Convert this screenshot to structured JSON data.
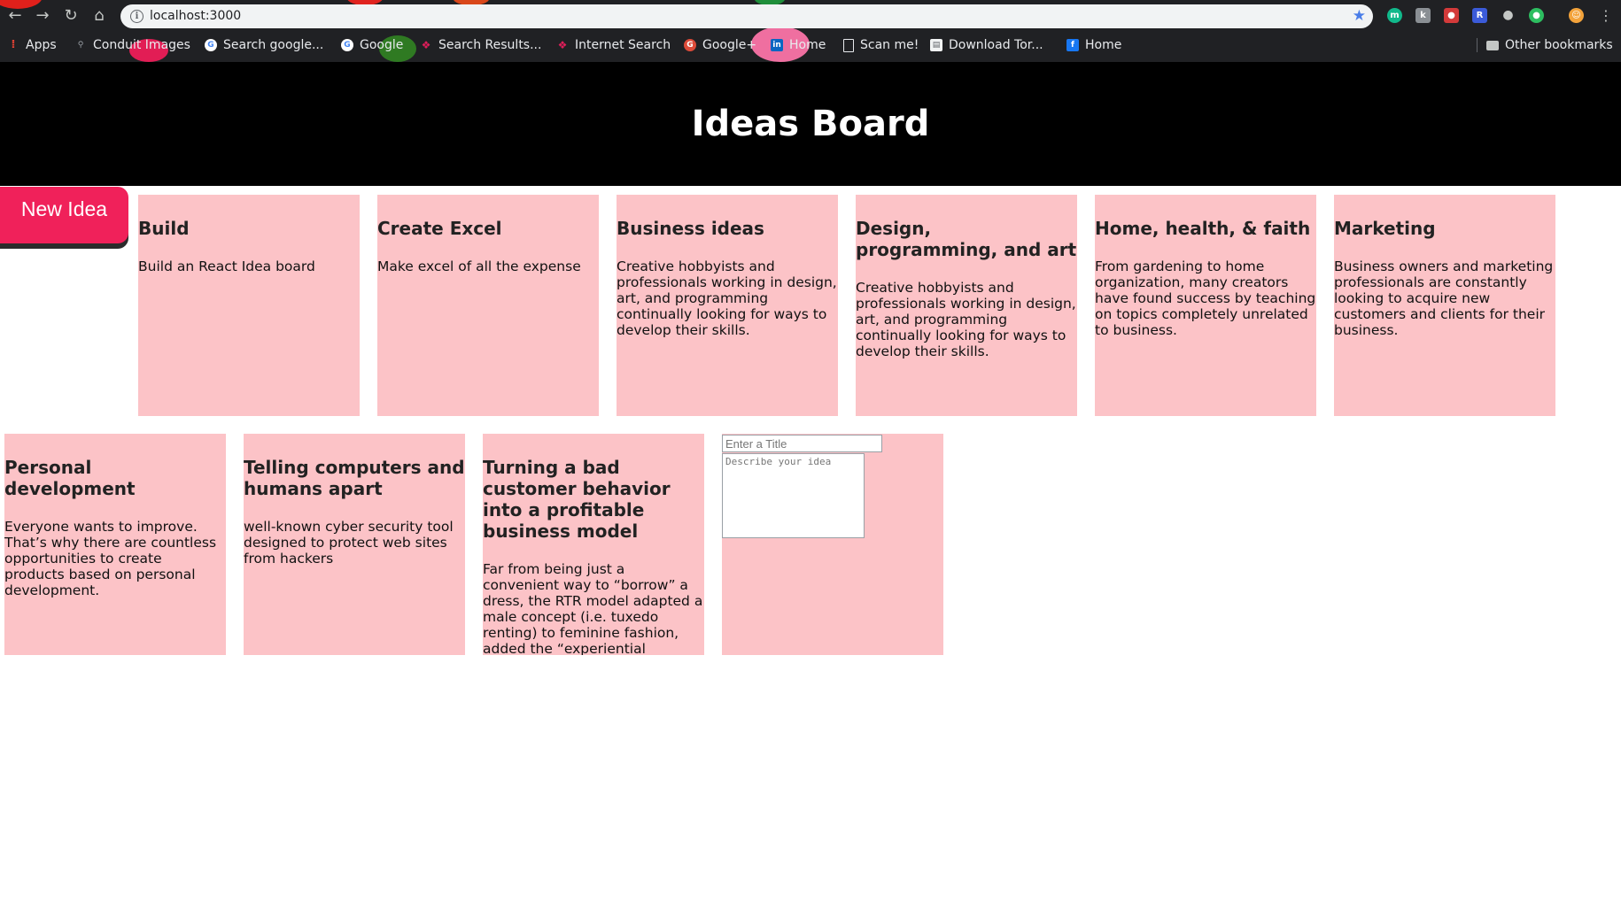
{
  "browser": {
    "url": "localhost:3000",
    "bookmarks": [
      {
        "label": "Apps",
        "icon": "apps-grid-icon",
        "color": "#ea4335"
      },
      {
        "label": "Conduit Images",
        "icon": "search-icon",
        "color": "#5f6368"
      },
      {
        "label": "Search google...",
        "icon": "google-icon",
        "color": "#ffffff"
      },
      {
        "label": "Google",
        "icon": "google-icon",
        "color": "#ffffff"
      },
      {
        "label": "Search Results...",
        "icon": "slack-icon",
        "color": "#e01e5a"
      },
      {
        "label": "Internet Search",
        "icon": "slack-icon",
        "color": "#e01e5a"
      },
      {
        "label": "Google+",
        "icon": "google-plus-icon",
        "color": "#dd4b39"
      },
      {
        "label": "Home",
        "icon": "linkedin-icon",
        "color": "#0a66c2"
      },
      {
        "label": "Scan me!",
        "icon": "page-icon",
        "color": "#e8eaed"
      },
      {
        "label": "Download Tor...",
        "icon": "tor-icon",
        "color": "#f1f3f4"
      },
      {
        "label": "Home",
        "icon": "facebook-icon",
        "color": "#1877f2"
      }
    ],
    "other_bookmarks": "Other bookmarks",
    "ext_letters": {
      "r": "R"
    }
  },
  "app": {
    "title": "Ideas Board",
    "new_idea_label": "New Idea",
    "tiles": [
      {
        "title": "Build",
        "body": "Build an React Idea board"
      },
      {
        "title": "Create Excel",
        "body": "Make excel of all the expense"
      },
      {
        "title": "Business ideas",
        "body": "Creative hobbyists and professionals working in design, art, and programming continually looking for ways to develop their skills."
      },
      {
        "title": "Design, programming, and art",
        "body": "Creative hobbyists and professionals working in design, art, and programming continually looking for ways to develop their skills."
      },
      {
        "title": "Home, health, & faith",
        "body": "From gardening to home organization, many creators have found success by teaching on topics completely unrelated to business."
      },
      {
        "title": "Marketing",
        "body": "Business owners and marketing professionals are constantly looking to acquire new customers and clients for their business."
      },
      {
        "title": "Personal development",
        "body": "Everyone wants to improve. That’s why there are countless opportunities to create products based on personal development."
      },
      {
        "title": "Telling computers and humans apart",
        "body": "well-known cyber security tool designed to protect web sites from hackers"
      },
      {
        "title": "Turning a bad customer behavior into a profitable business model",
        "body": "Far from being just a convenient way to “borrow” a dress, the RTR model adapted a male concept (i.e. tuxedo renting) to feminine fashion, added the “experiential marketing”"
      }
    ],
    "editor": {
      "title_placeholder": "Enter a Title",
      "body_placeholder": "Describe your idea"
    },
    "colors": {
      "tile_bg": "#fcc3c7",
      "header_bg": "#000000",
      "button_bg": "#f0215a"
    }
  }
}
